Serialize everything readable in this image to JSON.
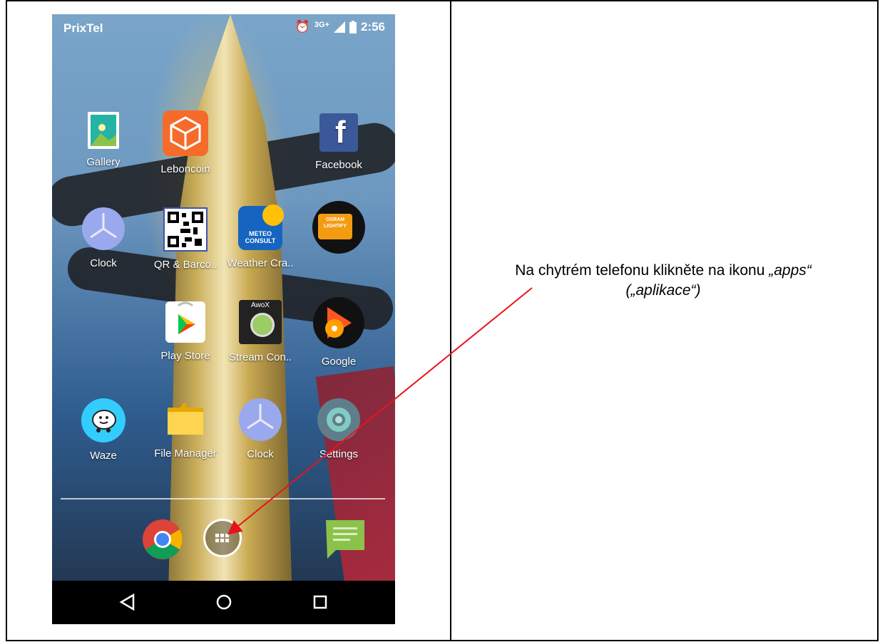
{
  "status_bar": {
    "carrier": "PrixTel",
    "network": "3G+",
    "time": "2:56",
    "icons": [
      "alarm-icon",
      "signal-icon",
      "battery-icon"
    ]
  },
  "apps": [
    {
      "label": "Gallery",
      "icon": "gallery-icon"
    },
    {
      "label": "Leboncoin",
      "icon": "leboncoin-icon"
    },
    {
      "label": "Facebook",
      "icon": "facebook-icon"
    },
    {
      "label": "Clock",
      "icon": "clock-icon"
    },
    {
      "label": "QR & Barco..",
      "icon": "qr-barcode-icon"
    },
    {
      "label": "Weather Cra..",
      "icon": "weather-icon",
      "badge": "METEO CONSULT"
    },
    {
      "label": "",
      "icon": "osram-lightify-icon",
      "badge": "OSRAM LIGHTIFY"
    },
    {
      "label": "Play Store",
      "icon": "play-store-icon"
    },
    {
      "label": "Stream Con..",
      "icon": "stream-control-icon",
      "badge": "AwoX"
    },
    {
      "label": "Google",
      "icon": "google-play-music-icon"
    },
    {
      "label": "Waze",
      "icon": "waze-icon"
    },
    {
      "label": "File Manager",
      "icon": "file-manager-icon"
    },
    {
      "label": "Clock",
      "icon": "clock-icon"
    },
    {
      "label": "Settings",
      "icon": "settings-icon"
    }
  ],
  "dock": [
    {
      "name": "chrome",
      "icon": "chrome-icon"
    },
    {
      "name": "apps",
      "icon": "apps-drawer-icon"
    },
    {
      "name": "messages",
      "icon": "messages-icon"
    }
  ],
  "nav": [
    "back",
    "home",
    "recents"
  ],
  "caption": {
    "line1_prefix": "Na chytrém telefonu klikněte na ikonu ",
    "line1_italic": "„apps“",
    "line2_italic": "(„aplikace“)"
  },
  "colors": {
    "arrow": "#e8141b",
    "facebook": "#3b5998",
    "leboncoin": "#f56b2a"
  }
}
